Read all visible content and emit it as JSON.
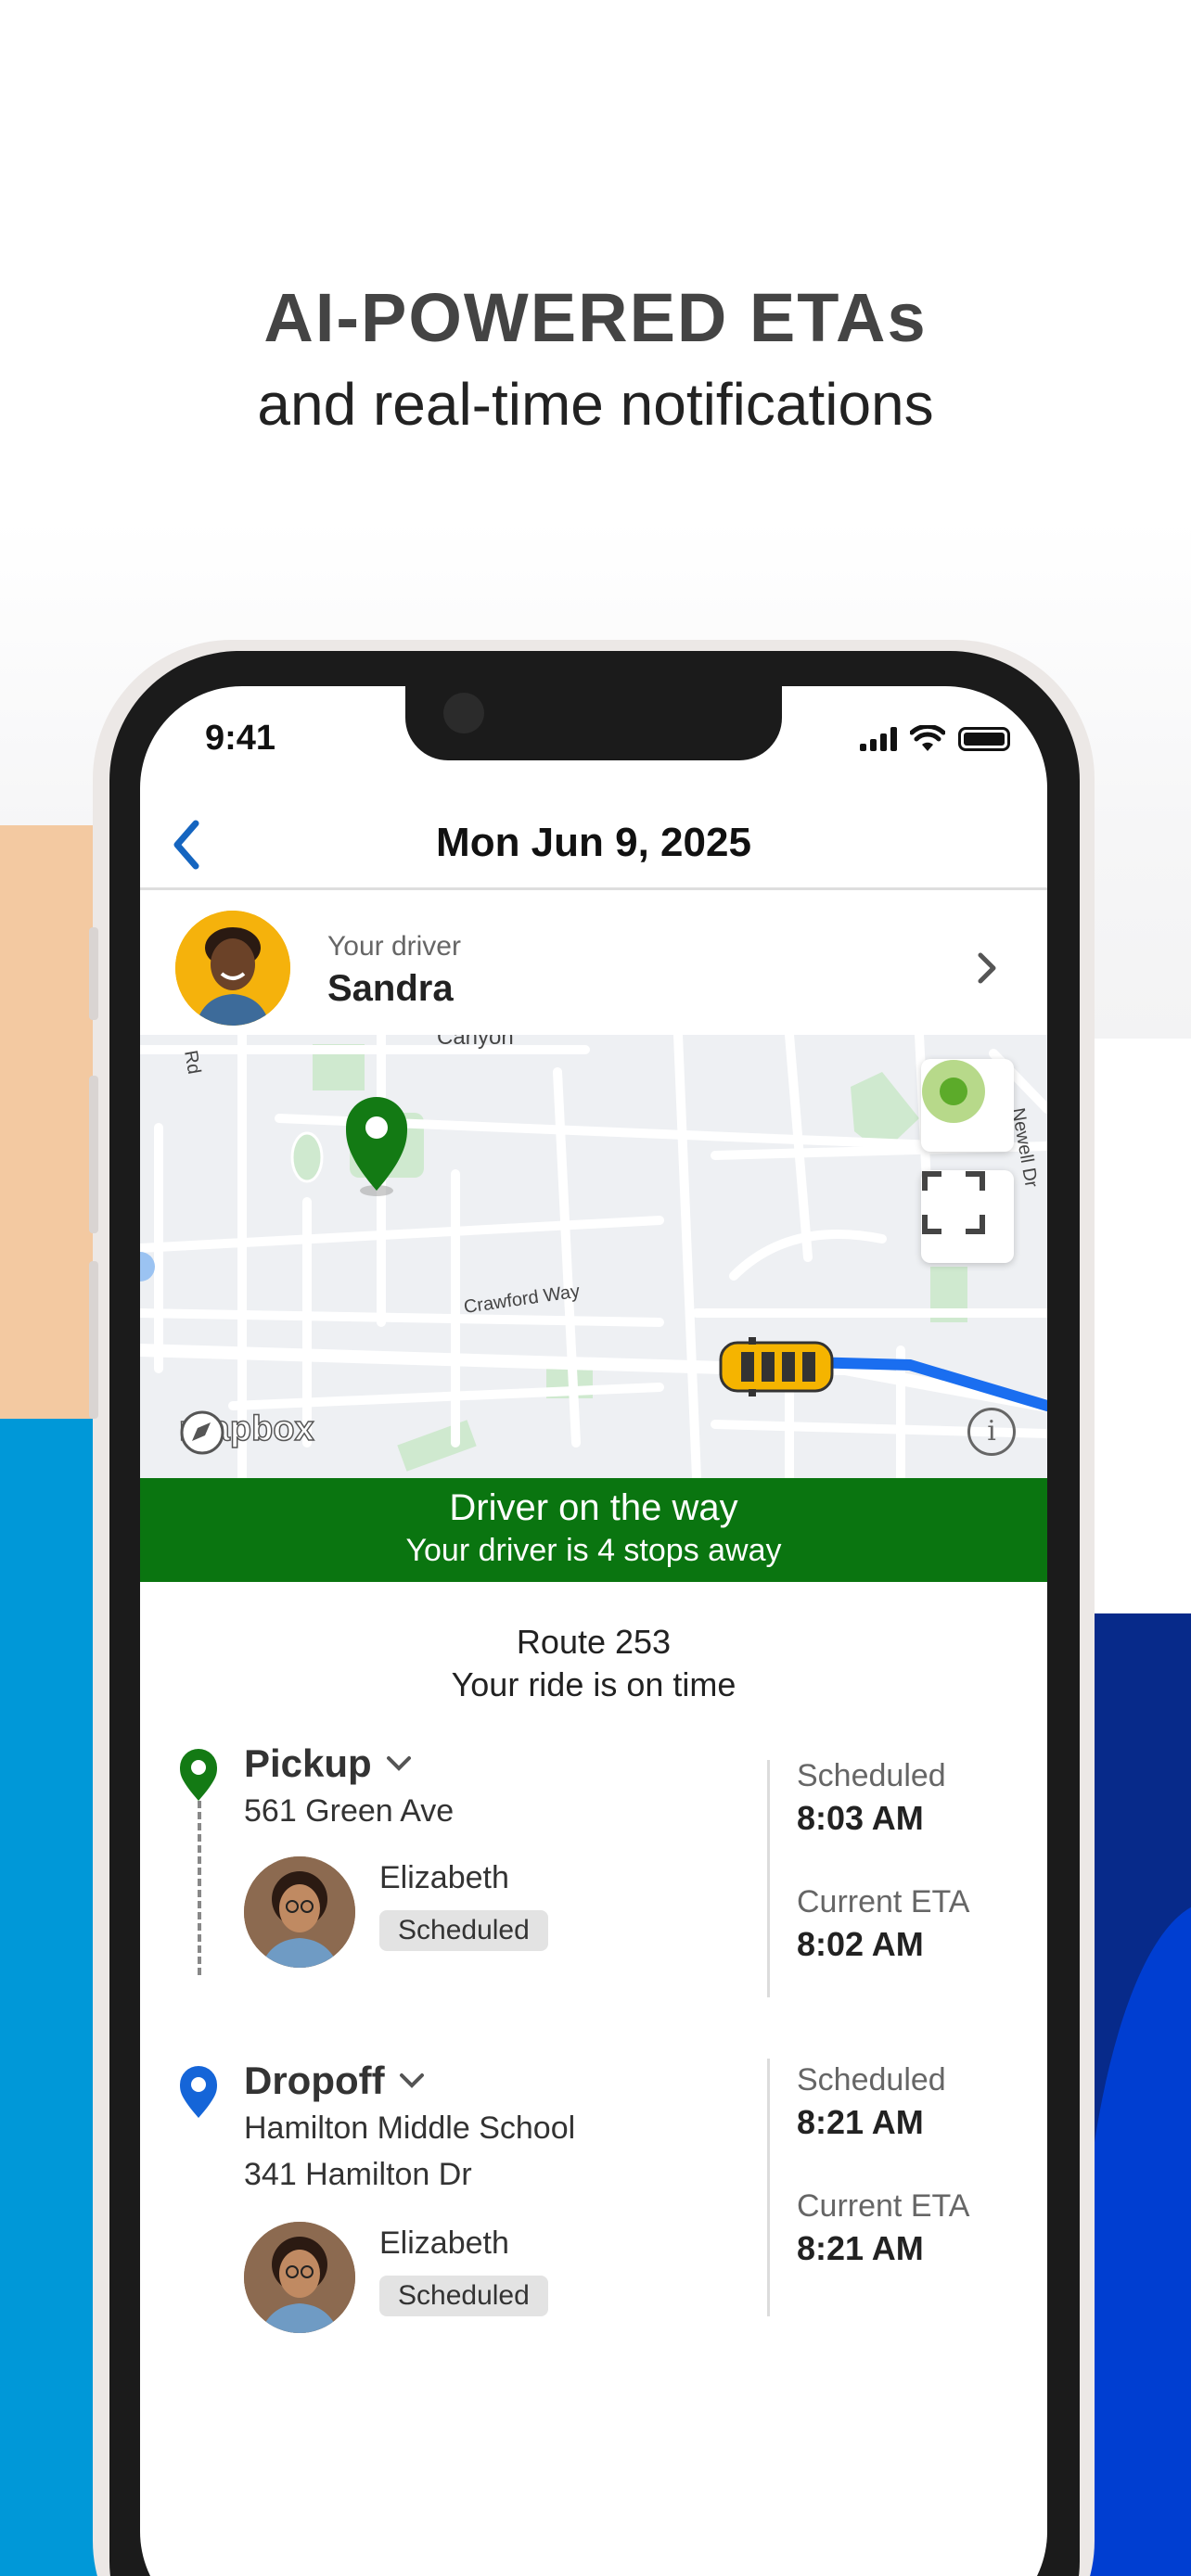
{
  "headline": {
    "title": "AI-POWERED ETAs",
    "subtitle": "and real-time notifications"
  },
  "status_bar": {
    "time": "9:41"
  },
  "nav": {
    "title": "Mon Jun 9, 2025"
  },
  "driver": {
    "label": "Your driver",
    "name": "Sandra"
  },
  "map": {
    "labels": {
      "canyon": "Canyon",
      "crawford": "Crawford Way",
      "newell": "Newell Dr",
      "rd": "Rd"
    },
    "logo": "mapbox"
  },
  "banner": {
    "title": "Driver on the way",
    "subtitle": "Your driver is 4 stops away"
  },
  "route": {
    "name": "Route 253",
    "status": "Your ride is on time"
  },
  "stops": [
    {
      "type": "Pickup",
      "address_line1": "561 Green Ave",
      "address_line2": "",
      "student": "Elizabeth",
      "badge": "Scheduled",
      "scheduled_label": "Scheduled",
      "scheduled_time": "8:03 AM",
      "eta_label": "Current ETA",
      "eta_time": "8:02 AM"
    },
    {
      "type": "Dropoff",
      "address_line1": "Hamilton Middle School",
      "address_line2": "341 Hamilton Dr",
      "student": "Elizabeth",
      "badge": "Scheduled",
      "scheduled_label": "Scheduled",
      "scheduled_time": "8:21 AM",
      "eta_label": "Current ETA",
      "eta_time": "8:21 AM"
    }
  ],
  "colors": {
    "accent_blue": "#1565c0",
    "banner_green": "#0a7510",
    "pickup_green": "#137a14",
    "dropoff_blue": "#1565d8"
  },
  "icons": [
    "back-chevron-icon",
    "chevron-right-icon",
    "location-pin-icon",
    "bus-icon",
    "recenter-icon",
    "fullscreen-icon",
    "info-icon",
    "chevron-down-icon"
  ]
}
